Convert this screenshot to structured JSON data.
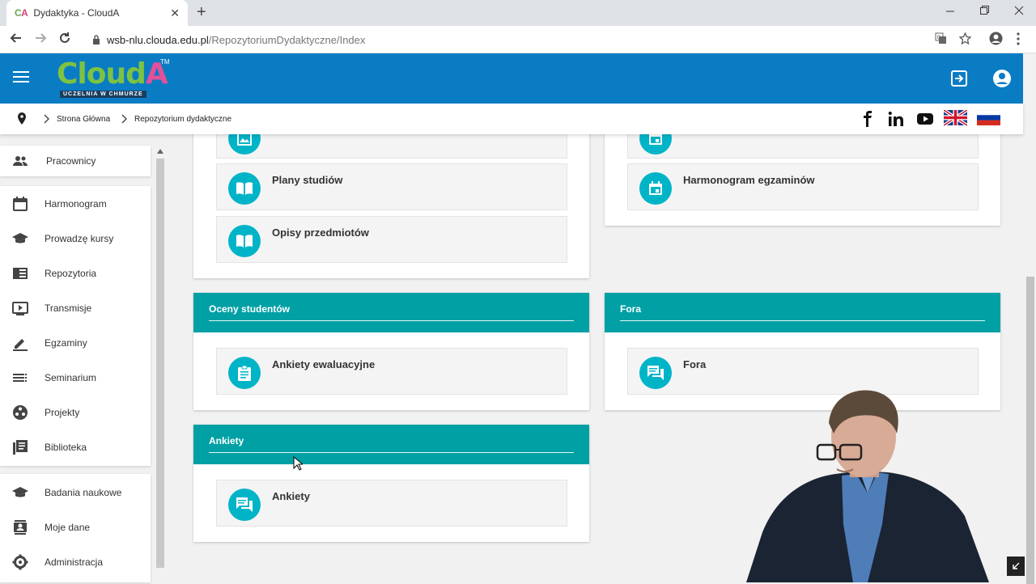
{
  "browser": {
    "tab_favicon_c": "C",
    "tab_favicon_a": "A",
    "tab_title": "Dydaktyka - CloudA",
    "tab_close": "✕",
    "new_tab": "+",
    "url_host": "wsb-nlu.clouda.edu.pl",
    "url_path": "/RepozytoriumDydaktyczne/Index"
  },
  "header": {
    "logo_cloud": "Cloud",
    "logo_a": "A",
    "logo_tm": "TM",
    "logo_tagline": "UCZELNIA W CHMURZE"
  },
  "breadcrumb": {
    "items": [
      "Strona Główna",
      "Repozytorium dydaktyczne"
    ]
  },
  "sidebar": {
    "items": [
      {
        "label": "Pracownicy",
        "icon": "people-icon"
      },
      {
        "label": "Harmonogram",
        "icon": "calendar-icon"
      },
      {
        "label": "Prowadzę kursy",
        "icon": "graduation-cap-icon"
      },
      {
        "label": "Repozytoria",
        "icon": "repository-icon"
      },
      {
        "label": "Transmisje",
        "icon": "video-icon"
      },
      {
        "label": "Egzaminy",
        "icon": "pencil-icon"
      },
      {
        "label": "Seminarium",
        "icon": "list-icon"
      },
      {
        "label": "Projekty",
        "icon": "projects-icon"
      },
      {
        "label": "Biblioteka",
        "icon": "library-icon"
      },
      {
        "label": "Badania naukowe",
        "icon": "graduation-cap-icon"
      },
      {
        "label": "Moje dane",
        "icon": "contact-icon"
      },
      {
        "label": "Administracja",
        "icon": "gear-icon"
      }
    ]
  },
  "cards": {
    "left_top": {
      "tiles": [
        {
          "label": "",
          "icon": "image-icon"
        },
        {
          "label": "Plany studiów",
          "icon": "book-icon"
        },
        {
          "label": "Opisy przedmiotów",
          "icon": "book-icon"
        }
      ]
    },
    "right_top": {
      "tiles": [
        {
          "label": "",
          "icon": "calendar-icon"
        },
        {
          "label": "Harmonogram egzaminów",
          "icon": "calendar-icon"
        }
      ]
    },
    "oceny": {
      "title": "Oceny studentów",
      "tiles": [
        {
          "label": "Ankiety ewaluacyjne",
          "icon": "clipboard-icon"
        }
      ]
    },
    "fora": {
      "title": "Fora",
      "tiles": [
        {
          "label": "Fora",
          "icon": "forum-icon"
        }
      ]
    },
    "ankiety": {
      "title": "Ankiety",
      "tiles": [
        {
          "label": "Ankiety",
          "icon": "forum-icon"
        }
      ]
    }
  },
  "colors": {
    "header_blue": "#0a7cc4",
    "card_teal": "#00a0a5",
    "icon_circle": "#00b4c8",
    "logo_green": "#7dc242",
    "logo_pink": "#e3509a"
  }
}
